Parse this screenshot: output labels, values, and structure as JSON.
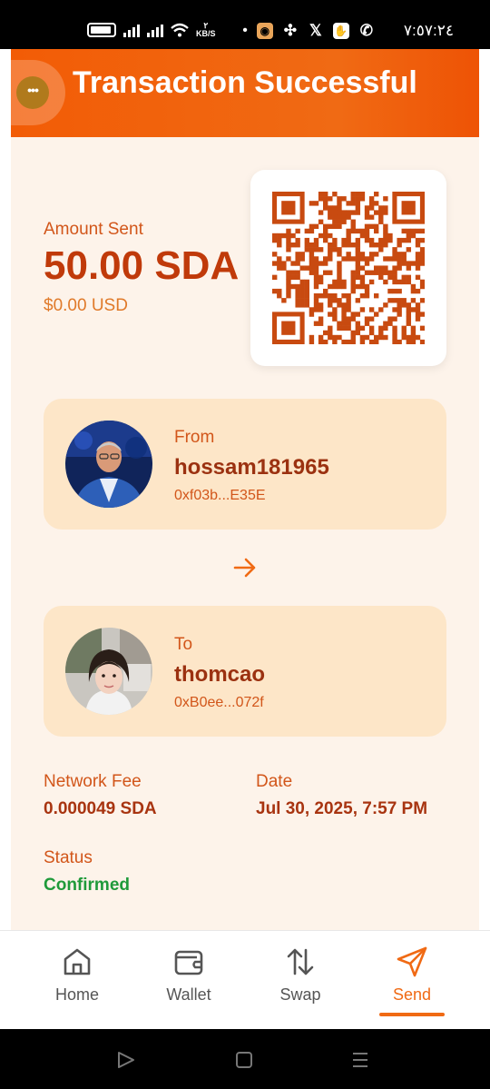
{
  "status_bar": {
    "speed_top": "٢",
    "speed_unit": "KB/S",
    "dot": "•",
    "time": "٧:٥٧:٢٤",
    "notification_icons": [
      "market-icon",
      "pinwheel-icon",
      "x-icon",
      "hand-icon",
      "whatsapp-icon"
    ]
  },
  "header": {
    "title": "Transaction Successful",
    "menu_icon": "more-dots-icon",
    "menu_dots": "•••"
  },
  "amount": {
    "label": "Amount Sent",
    "value": "50.00 SDA",
    "usd": "$0.00 USD"
  },
  "qr": {
    "icon": "qr-code"
  },
  "from": {
    "label": "From",
    "name": "hossam181965",
    "address": "0xf03b...E35E"
  },
  "to": {
    "label": "To",
    "name": "thomcao",
    "address": "0xB0ee...072f"
  },
  "details": {
    "fee_label": "Network Fee",
    "fee_value": "0.000049 SDA",
    "date_label": "Date",
    "date_value": "Jul 30, 2025, 7:57 PM",
    "status_label": "Status",
    "status_value": "Confirmed"
  },
  "bottom_nav": {
    "items": [
      {
        "label": "Home",
        "icon": "home-icon"
      },
      {
        "label": "Wallet",
        "icon": "wallet-icon"
      },
      {
        "label": "Swap",
        "icon": "swap-icon"
      },
      {
        "label": "Send",
        "icon": "send-icon"
      }
    ],
    "active": "Send"
  },
  "colors": {
    "accent": "#f06a14",
    "header": "#f25c06",
    "page_bg": "#fdf3ea",
    "card_bg": "#fde6c8",
    "text_strong": "#c03a0a",
    "text_label": "#d2561a",
    "success": "#1f9a3a"
  }
}
